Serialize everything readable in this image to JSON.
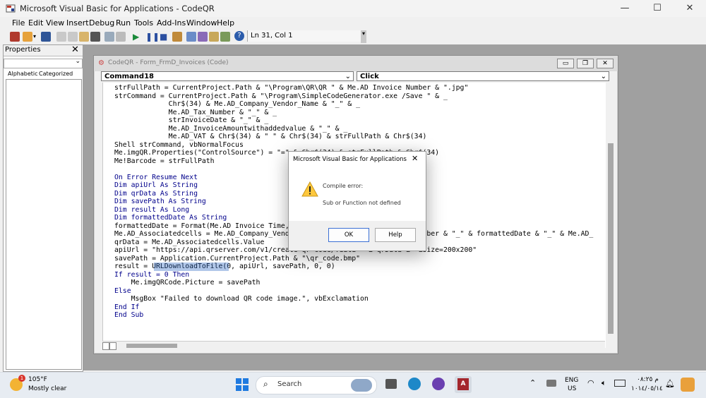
{
  "window": {
    "title": "Microsoft Visual Basic for Applications - CodeQR"
  },
  "menu": [
    "File",
    "Edit",
    "View",
    "Insert",
    "Debug",
    "Run",
    "Tools",
    "Add-Ins",
    "Window",
    "Help"
  ],
  "toolbar": {
    "position": "Ln 31, Col 1"
  },
  "properties": {
    "title": "Properties",
    "tab_alpha": "Alphabetic",
    "tab_cat": "Categorized"
  },
  "codewin": {
    "title": "CodeQR - Form_FrmD_Invoices (Code)",
    "object_combo": "Command18",
    "proc_combo": "Click",
    "lines": [
      "strFullPath = CurrentProject.Path & \"\\Program\\QR\\QR \" & Me.AD Invoice Number & \".jpg\"",
      "strCommand = CurrentProject.Path & \"\\Program\\SimpleCodeGenerator.exe /Save \" & _",
      "             Chr$(34) & Me.AD_Company_Vendor_Name & \"_\" & _",
      "             Me.AD_Tax_Number & \"_\" & _",
      "             strInvoiceDate & \"_\" & _",
      "             Me.AD_InvoiceAmountwithaddedvalue & \"_\" & _",
      "             Me.AD_VAT & Chr$(34) & \" \" & Chr$(34) & strFullPath & Chr$(34)",
      "Shell strCommand, vbNormalFocus",
      "Me.imgQR.Properties(\"ControlSource\") = \"=\" & Chr$(34) & strFullPath & Chr$(34)",
      "Me!Barcode = strFullPath",
      "",
      "On Error Resume Next",
      "Dim apiUrl As String",
      "Dim qrData As String",
      "Dim savePath As String",
      "Dim result As Long",
      "Dim formattedDate As String",
      "formattedDate = Format(Me.AD Invoice Time, \"yyyy-mm-dd hh-nn-ss ampm\")",
      "Me.AD_Associatedcells = Me.AD_Company_Vendor_Name & \"_\" & Me.AD Invoice Number & \"_\" & formattedDate & \"_\" & Me.AD_",
      "qrData = Me.AD_Associatedcells.Value",
      "apiUrl = \"https://api.qrserver.com/v1/create-qr-code/?data=\" & qrData & \"&size=200x200\"",
      "savePath = Application.CurrentProject.Path & \"\\qr_code.bmp\"",
      "result = URLDownloadToFile(0, apiUrl, savePath, 0, 0)",
      "If result = 0 Then",
      "    Me.imgQRCode.Picture = savePath",
      "Else",
      "    MsgBox \"Failed to download QR code image.\", vbExclamation",
      "End If",
      "End Sub"
    ]
  },
  "dialog": {
    "title": "Microsoft Visual Basic for Applications",
    "heading": "Compile error:",
    "message": "Sub or Function not defined",
    "ok": "OK",
    "help": "Help"
  },
  "taskbar": {
    "temp": "105°F",
    "weather": "Mostly clear",
    "weather_badge": "1",
    "search": "Search",
    "lang1": "ENG",
    "lang2": "US",
    "time": "م ٠٨:٢٥",
    "date": "١٠١٤/٠٥/١٤"
  },
  "colors": {
    "keyword": "#00008b",
    "highlight": "#1f5fbf",
    "warning": "#ffc83d"
  }
}
